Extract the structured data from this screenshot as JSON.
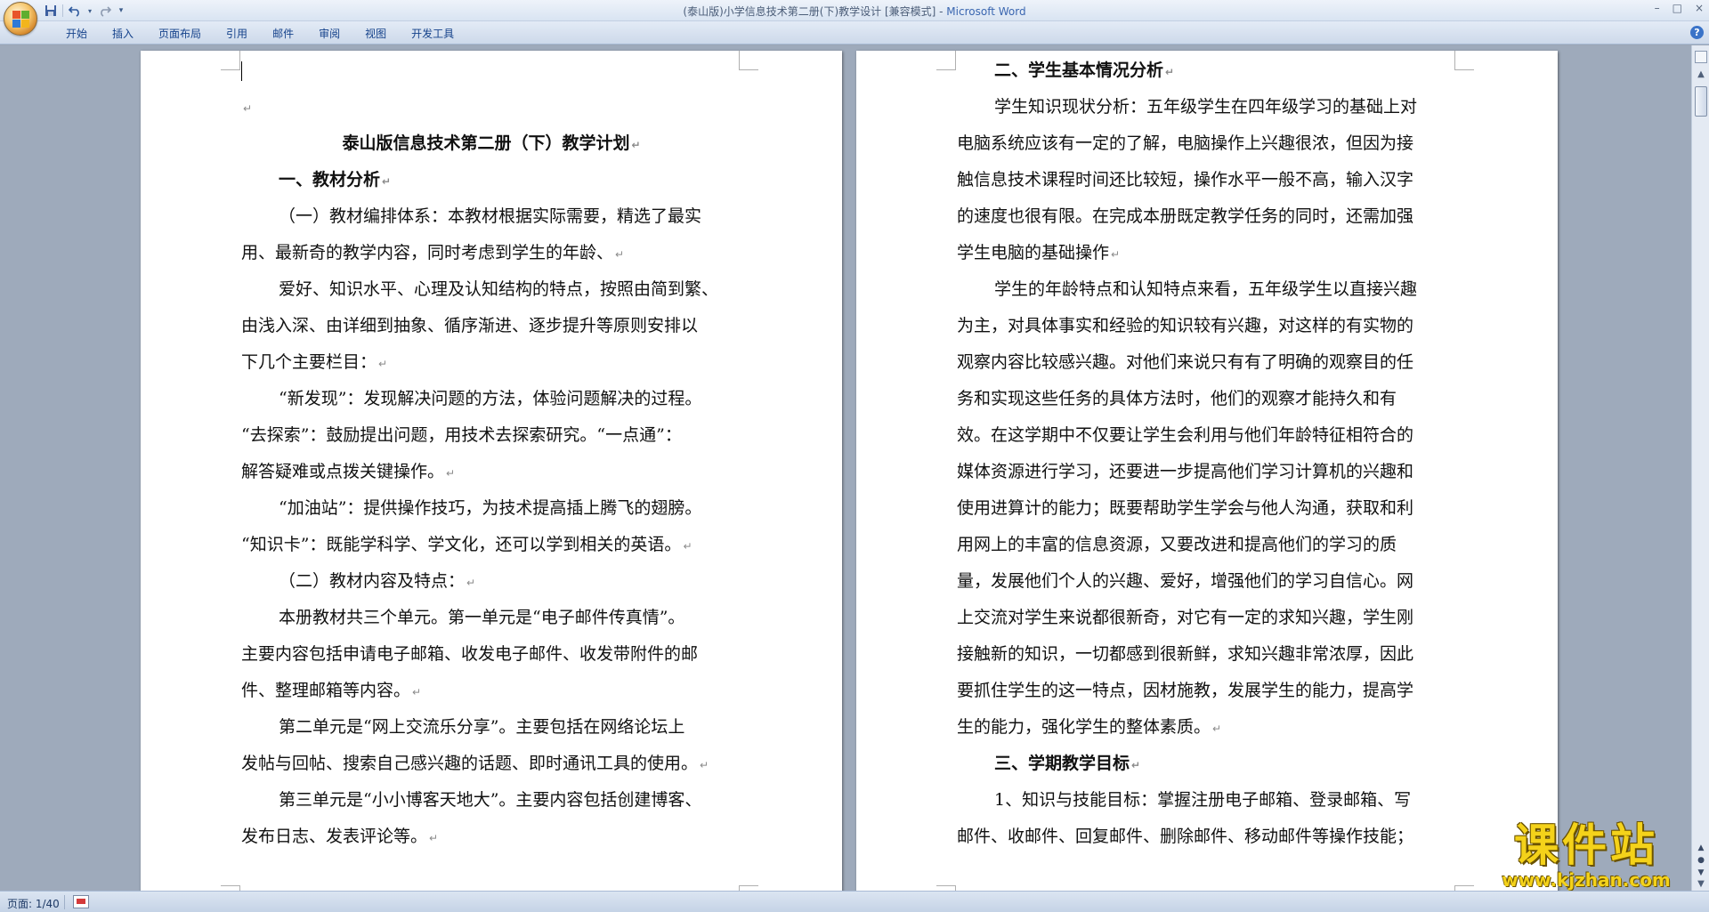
{
  "window": {
    "title": "(泰山版)小学信息技术第二册(下)教学设计 [兼容模式] - ",
    "app_name": "Microsoft Word",
    "controls": [
      "–",
      "□",
      "×"
    ]
  },
  "qat": {
    "save_icon": "save-icon",
    "undo_icon": "undo-icon",
    "redo_icon": "redo-icon",
    "customize_icon": "dropdown-icon"
  },
  "ribbon": {
    "tabs": [
      "开始",
      "插入",
      "页面布局",
      "引用",
      "邮件",
      "审阅",
      "视图",
      "开发工具"
    ],
    "help": "?"
  },
  "colors": {
    "title_accent": "#3a66b0",
    "tab_text": "#15428b",
    "watermark": "#f4d21a"
  },
  "left_page": {
    "lines": [
      "",
      "",
      "泰山版信息技术第二册（下）教学计划",
      "一、教材分析",
      "（一）教材编排体系：本教材根据实际需要，精选了最实",
      "用、最新奇的教学内容，同时考虑到学生的年龄、",
      "爱好、知识水平、心理及认知结构的特点，按照由简到繁、",
      "由浅入深、由详细到抽象、循序渐进、逐步提升等原则安排以",
      "下几个主要栏目：",
      "“新发现”：发现解决问题的方法，体验问题解决的过程。",
      "“去探索”：鼓励提出问题，用技术去探索研究。“一点通”：",
      "解答疑难或点拨关键操作。",
      "“加油站”：提供操作技巧，为技术提高插上腾飞的翅膀。",
      "“知识卡”：既能学科学、学文化，还可以学到相关的英语。",
      "（二）教材内容及特点：",
      "本册教材共三个单元。第一单元是“电子邮件传真情”。",
      "主要内容包括申请电子邮箱、收发电子邮件、收发带附件的邮",
      "件、整理邮箱等内容。",
      "第二单元是“网上交流乐分享”。主要包括在网络论坛上",
      "发帖与回帖、搜索自己感兴趣的话题、即时通讯工具的使用。",
      "第三单元是“小小博客天地大”。主要内容包括创建博客、",
      "发布日志、发表评论等。"
    ]
  },
  "right_page": {
    "lines": [
      "二、学生基本情况分析",
      "学生知识现状分析：五年级学生在四年级学习的基础上对",
      "电脑系统应该有一定的了解，电脑操作上兴趣很浓，但因为接",
      "触信息技术课程时间还比较短，操作水平一般不高，输入汉字",
      "的速度也很有限。在完成本册既定教学任务的同时，还需加强",
      "学生电脑的基础操作",
      "学生的年龄特点和认知特点来看，五年级学生以直接兴趣",
      "为主，对具体事实和经验的知识较有兴趣，对这样的有实物的",
      "观察内容比较感兴趣。对他们来说只有有了明确的观察目的任",
      "务和实现这些任务的具体方法时，他们的观察才能持久和有",
      "效。在这学期中不仅要让学生会利用与他们年龄特征相符合的",
      "媒体资源进行学习，还要进一步提高他们学习计算机的兴趣和",
      "使用进算计的能力；既要帮助学生学会与他人沟通，获取和利",
      "用网上的丰富的信息资源，又要改进和提高他们的学习的质",
      "量，发展他们个人的兴趣、爱好，增强他们的学习自信心。网",
      "上交流对学生来说都很新奇，对它有一定的求知兴趣，学生刚",
      "接触新的知识，一切都感到很新鲜，求知兴趣非常浓厚，因此",
      "要抓住学生的这一特点，因材施教，发展学生的能力，提高学",
      "生的能力，强化学生的整体素质。",
      "三、学期教学目标",
      "1、知识与技能目标：掌握注册电子邮箱、登录邮箱、写",
      "邮件、收邮件、回复邮件、删除邮件、移动邮件等操作技能；"
    ]
  },
  "paragraph_mark": "↵",
  "statusbar": {
    "page_info": "页面: 1/40"
  },
  "watermark": {
    "title": "课件站",
    "url": "www.kjzhan.com"
  }
}
